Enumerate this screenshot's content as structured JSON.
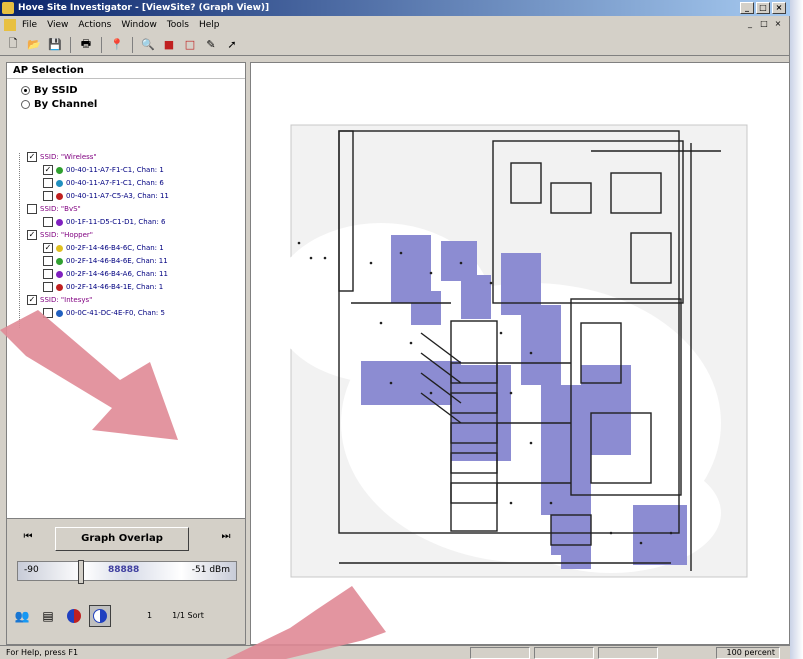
{
  "window": {
    "title": "Hove Site Investigator - [ViewSite? (Graph View)]",
    "controls": [
      "_",
      "□",
      "×"
    ]
  },
  "menu": {
    "items": [
      "File",
      "View",
      "Actions",
      "Window",
      "Tools",
      "Help"
    ],
    "mdi_controls": [
      "_",
      "□",
      "×"
    ]
  },
  "toolbar": {
    "icons": [
      "new-icon",
      "open-icon",
      "save-icon",
      "print-icon",
      "pin-icon",
      "zoom-icon",
      "record-icon",
      "stop-icon",
      "pencil-icon",
      "pointer-icon"
    ]
  },
  "left_panel": {
    "header": "AP Selection",
    "radio_ssid": "By SSID",
    "radio_channel": "By Channel",
    "selected_mode": "By SSID",
    "tree": [
      {
        "type": "ssid",
        "label": "SSID: \"Wireless\"",
        "checked": true
      },
      {
        "type": "ap",
        "label": "00-40-11-A7-F1-C1, Chan: 1",
        "color": "#30a030",
        "checked": true
      },
      {
        "type": "ap",
        "label": "00-40-11-A7-F1-C1, Chan: 6",
        "color": "#2090c0",
        "checked": false
      },
      {
        "type": "ap",
        "label": "00-40-11-A7-C5-A3, Chan: 11",
        "color": "#c02020",
        "checked": false
      },
      {
        "type": "ssid",
        "label": "SSID: \"BvS\"",
        "checked": false
      },
      {
        "type": "ap",
        "label": "00-1F-11-D5-C1-D1, Chan: 6",
        "color": "#8020c0",
        "checked": false
      },
      {
        "type": "ssid",
        "label": "SSID: \"Hopper\"",
        "checked": true
      },
      {
        "type": "ap",
        "label": "00-2F-14-46-B4-6C, Chan: 1",
        "color": "#e0c020",
        "checked": true
      },
      {
        "type": "ap",
        "label": "00-2F-14-46-B4-6E, Chan: 11",
        "color": "#30a030",
        "checked": false
      },
      {
        "type": "ap",
        "label": "00-2F-14-46-B4-A6, Chan: 11",
        "color": "#8020c0",
        "checked": false
      },
      {
        "type": "ap",
        "label": "00-2F-14-46-B4-1E, Chan: 1",
        "color": "#c02020",
        "checked": false
      },
      {
        "type": "ssid",
        "label": "SSID: \"Intesys\"",
        "checked": true
      },
      {
        "type": "ap",
        "label": "00-0C-41-DC-4E-F0, Chan: 5",
        "color": "#2060c0",
        "checked": false
      }
    ],
    "graph_overlap_button": "Graph Overlap",
    "slider_low": "-90",
    "slider_high": "-51 dBm",
    "slider_mid": "88888",
    "selection_label": "1",
    "selection_count": "1/1 Sort"
  },
  "status": {
    "left": "For Help, press F1",
    "right": "100 percent"
  }
}
